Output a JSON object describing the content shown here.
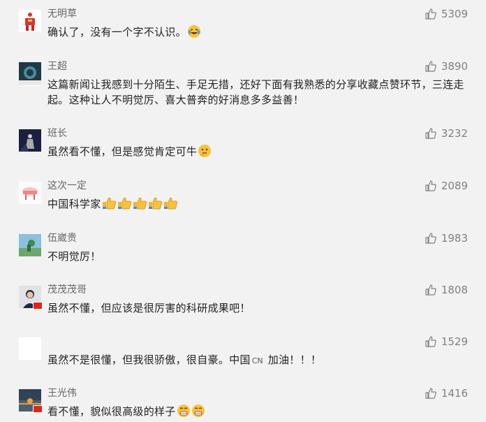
{
  "comments": [
    {
      "user": "无明草",
      "text": "确认了，没有一个字不认识。",
      "likes": "5309",
      "emoji": "laugh-cry-emoji"
    },
    {
      "user": "王超",
      "text": "这篇新闻让我感到十分陌生、手足无措，还好下面有我熟悉的分享收藏点赞环节，三连走起。这种让人不明觉厉、喜大普奔的好消息多多益善！",
      "likes": "3890"
    },
    {
      "user": "班长",
      "text": "虽然看不懂，但是感觉肯定可牛",
      "likes": "3232",
      "emoji": "thinking-emoji"
    },
    {
      "user": "这次一定",
      "text": "中国科学家",
      "likes": "2089",
      "emoji": "thumbs-up-emoji"
    },
    {
      "user": "伍崴贵",
      "text": "不明觉厉！",
      "likes": "1983"
    },
    {
      "user": "茂茂茂哥",
      "text": "虽然不懂，但应该是很厉害的科研成果吧！",
      "likes": "1808"
    },
    {
      "user": "",
      "text_before": "虽然不是很懂，但我很骄傲，很自豪。中国",
      "tag": "CN",
      "text_after": " 加油！！！",
      "likes": "1529"
    },
    {
      "user": "王光伟",
      "text": "看不懂，貌似很高级的样子",
      "likes": "1416",
      "emoji": "grin-emoji"
    }
  ],
  "colors": {
    "background": "#f2f2f2",
    "text": "#222222",
    "muted": "#808080"
  }
}
